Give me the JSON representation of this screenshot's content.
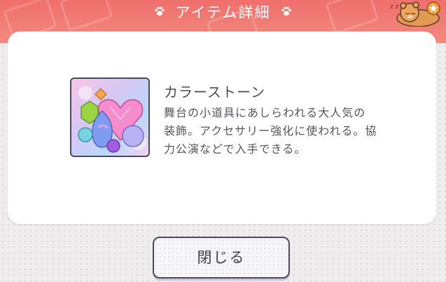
{
  "header": {
    "title": "アイテム詳細"
  },
  "item": {
    "name": "カラーストーン",
    "description": "舞台の小道具にあしらわれる大人気の装飾。アクセサリー強化に使われる。協力公演などで入手できる。"
  },
  "footer": {
    "close_label": "閉じる"
  },
  "colors": {
    "header_band": "#ef6f6c",
    "card_background": "#ffffff",
    "text_primary": "#4b4b58",
    "button_border": "#4a4a5e"
  },
  "icons": [
    "paw-icon",
    "mascot-icon",
    "color-stone-icon"
  ]
}
